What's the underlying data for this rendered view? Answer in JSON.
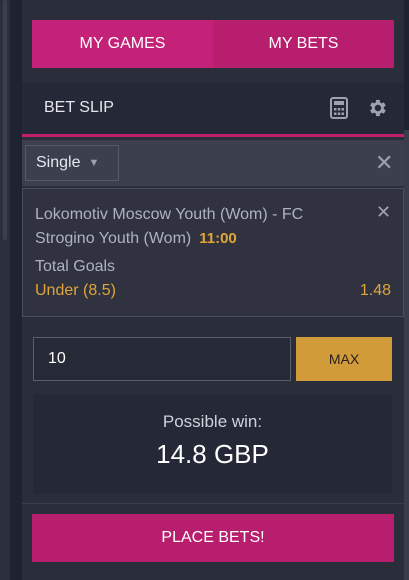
{
  "tabs": {
    "my_games": "MY GAMES",
    "my_bets": "MY BETS"
  },
  "slip": {
    "title": "BET SLIP",
    "type_selected": "Single"
  },
  "bet": {
    "match": "Lokomotiv Moscow Youth (Wom) - FC Strogino Youth (Wom)",
    "time": "11:00",
    "market": "Total Goals",
    "selection": "Under (8.5)",
    "odds": "1.48"
  },
  "stake": {
    "value": "10",
    "max_label": "MAX"
  },
  "win": {
    "label": "Possible win:",
    "value": "14.8 GBP"
  },
  "place_label": "PLACE BETS!",
  "icons": [
    "calculator-icon",
    "gear-icon",
    "dropdown-arrow-icon",
    "close-icon"
  ],
  "colors": {
    "accent": "#b81e6e",
    "gold": "#e0a53a",
    "max_button": "#d29b3a"
  }
}
